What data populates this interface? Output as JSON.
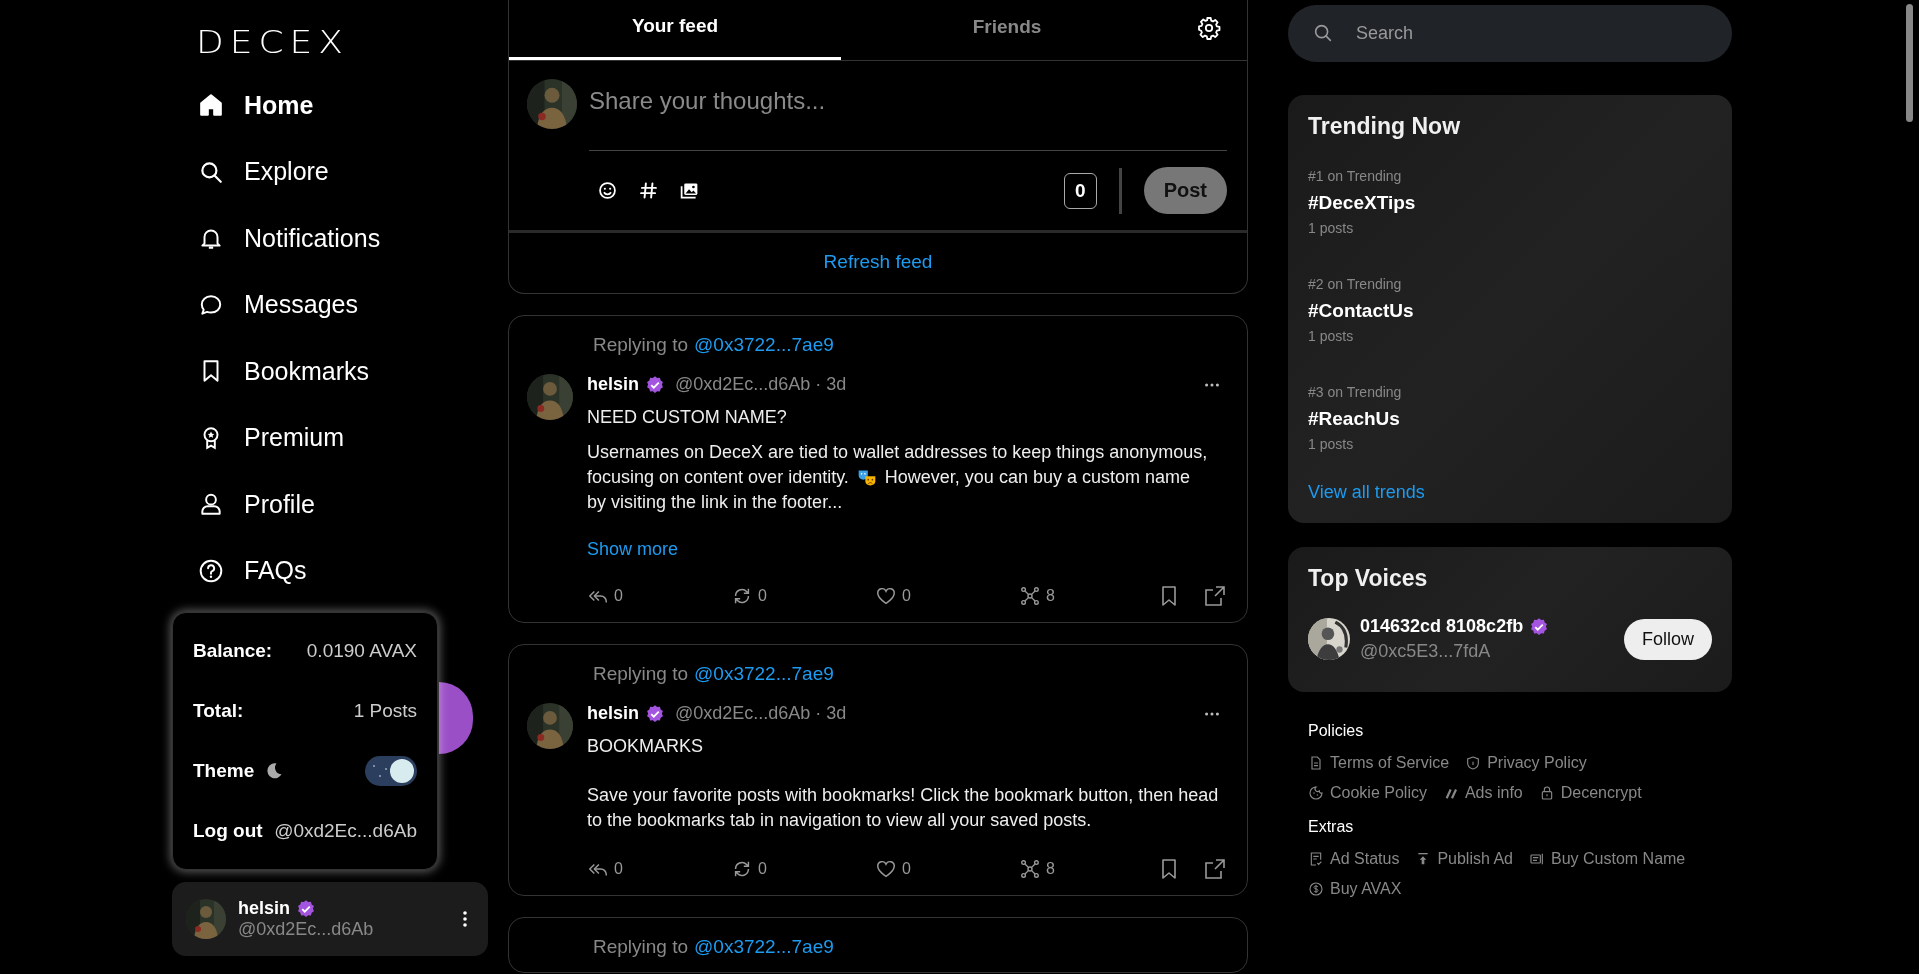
{
  "logo": "DECEX",
  "nav": [
    {
      "label": "Home",
      "selected": true
    },
    {
      "label": "Explore",
      "selected": false
    },
    {
      "label": "Notifications",
      "selected": false
    },
    {
      "label": "Messages",
      "selected": false
    },
    {
      "label": "Bookmarks",
      "selected": false
    },
    {
      "label": "Premium",
      "selected": false
    },
    {
      "label": "Profile",
      "selected": false
    },
    {
      "label": "FAQs",
      "selected": false
    }
  ],
  "account_card": {
    "rows": [
      {
        "label": "Balance:",
        "value": "0.0190 AVAX"
      },
      {
        "label": "Total:",
        "value": "1 Posts"
      }
    ],
    "theme_label": "Theme",
    "theme_dark": true,
    "logout_label": "Log out",
    "logout_handle": "@0xd2Ec...d6Ab"
  },
  "user": {
    "name": "helsin",
    "verified": true,
    "handle": "@0xd2Ec...d6Ab"
  },
  "tabs": [
    {
      "label": "Your feed",
      "selected": true
    },
    {
      "label": "Friends",
      "selected": false
    }
  ],
  "composer": {
    "placeholder": "Share your thoughts...",
    "count": "0",
    "button": "Post"
  },
  "refresh": "Refresh feed",
  "posts": [
    {
      "reply_label": "Replying to",
      "reply_to": "@0x3722...7ae9",
      "author": "helsin",
      "verified": true,
      "meta": "@0xd2Ec...d6Ab · 3d",
      "body": [
        {
          "kind": "text",
          "text": "NEED CUSTOM NAME?"
        },
        {
          "kind": "emoji",
          "before": [
            "Usernames on DeceX are tied to wallet addresses to keep things anonymous,",
            "focusing on content over identity."
          ],
          "after": [
            "However, you can buy a custom name",
            "by visiting the link in the footer..."
          ]
        }
      ],
      "show_more": "Show more",
      "actions": [
        {
          "kind": "reply",
          "count": "0"
        },
        {
          "kind": "repost",
          "count": "0"
        },
        {
          "kind": "like",
          "count": "0"
        },
        {
          "kind": "views",
          "count": "8"
        }
      ]
    },
    {
      "reply_label": "Replying to",
      "reply_to": "@0x3722...7ae9",
      "author": "helsin",
      "verified": true,
      "meta": "@0xd2Ec...d6Ab · 3d",
      "body": [
        {
          "kind": "text",
          "text": "BOOKMARKS"
        },
        {
          "kind": "text",
          "text": "Save your favorite posts with bookmarks! Click the bookmark button, then head to the bookmarks tab in navigation to view all your saved posts."
        }
      ],
      "actions": [
        {
          "kind": "reply",
          "count": "0"
        },
        {
          "kind": "repost",
          "count": "0"
        },
        {
          "kind": "like",
          "count": "0"
        },
        {
          "kind": "views",
          "count": "8"
        }
      ]
    },
    {
      "reply_label": "Replying to",
      "reply_to": "@0x3722...7ae9"
    }
  ],
  "search": {
    "placeholder": "Search"
  },
  "trending": {
    "title": "Trending Now",
    "items": [
      {
        "rank": "#1 on Trending",
        "tag": "#DeceXTips",
        "count": "1 posts"
      },
      {
        "rank": "#2 on Trending",
        "tag": "#ContactUs",
        "count": "1 posts"
      },
      {
        "rank": "#3 on Trending",
        "tag": "#ReachUs",
        "count": "1 posts"
      }
    ],
    "link": "View all trends"
  },
  "top_voices": {
    "title": "Top Voices",
    "users": [
      {
        "name": "014632cd 8108c2fb",
        "verified": true,
        "handle": "@0xc5E3...7fdA",
        "button": "Follow"
      }
    ]
  },
  "footer": [
    {
      "title": "Policies",
      "links": [
        "Terms of Service",
        "Privacy Policy",
        "Cookie Policy",
        "Ads info",
        "Decencrypt"
      ]
    },
    {
      "title": "Extras",
      "links": [
        "Ad Status",
        "Publish Ad",
        "Buy Custom Name",
        "Buy AVAX"
      ]
    }
  ]
}
